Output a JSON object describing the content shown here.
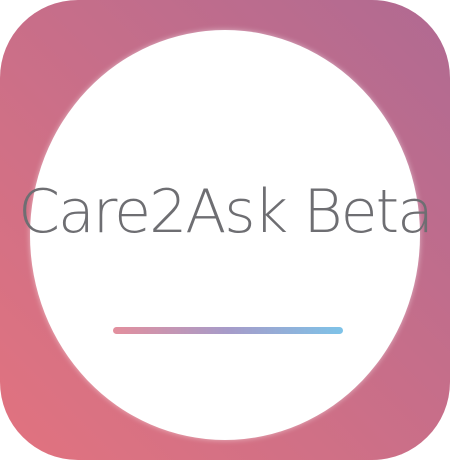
{
  "app": {
    "name": "Care2Ask Beta"
  },
  "colors": {
    "tile_gradient_start": "#e2737f",
    "tile_gradient_end": "#b06a92",
    "circle_fill": "#ffffff",
    "text_color": "#6e6e72",
    "underline_start": "#e38f9d",
    "underline_mid": "#a69bc9",
    "underline_end": "#7ec3e8"
  }
}
